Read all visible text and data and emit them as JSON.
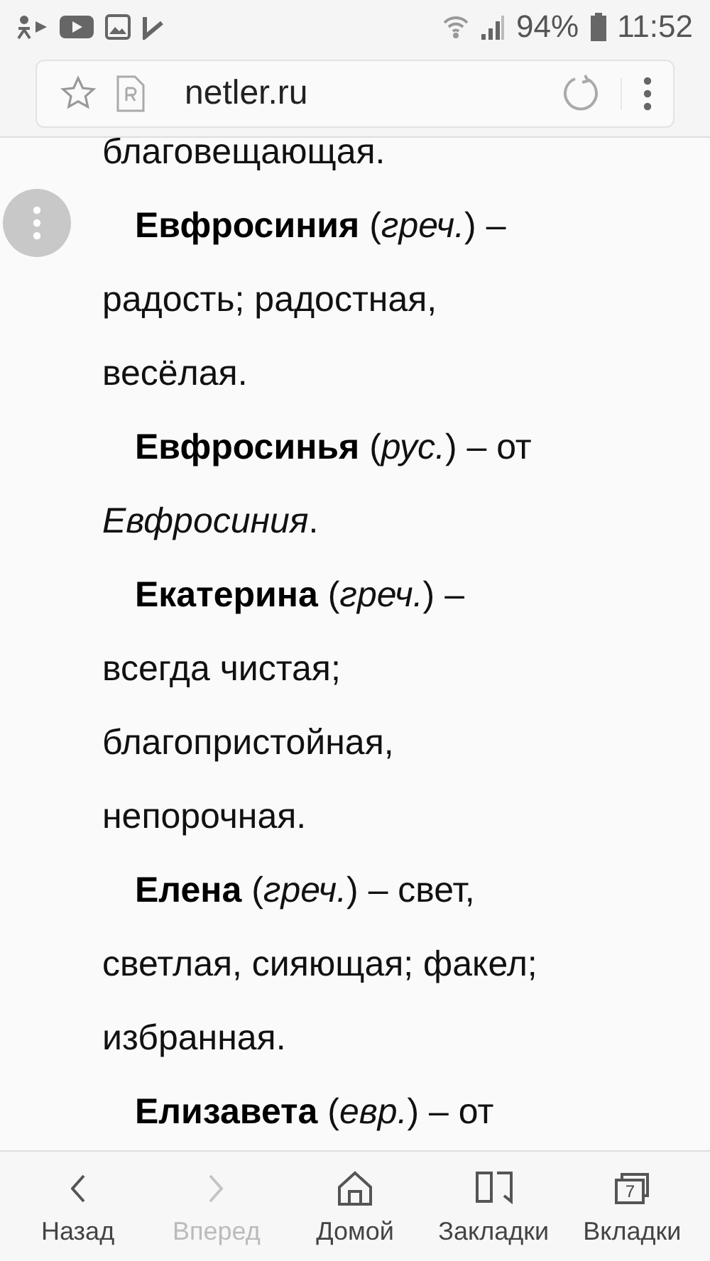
{
  "status_bar": {
    "battery": "94%",
    "time": "11:52"
  },
  "address_bar": {
    "url": "netler.ru"
  },
  "article": {
    "paragraphs": [
      {
        "continued": true,
        "lines": [
          "благовещающая."
        ]
      },
      {
        "continued": false,
        "lines": [
          "**Евфросиния** (*греч.*) –",
          "радость; радостная,",
          "весёлая."
        ]
      },
      {
        "continued": false,
        "lines": [
          "**Евфросинья** (*рус.*) – от",
          "*Евфросиния*."
        ]
      },
      {
        "continued": false,
        "lines": [
          "**Екатерина** (*греч.*) –",
          "всегда чистая;",
          "благопристойная,",
          "непорочная."
        ]
      },
      {
        "continued": false,
        "lines": [
          "**Елена** (*греч.*) – свет,",
          "светлая, сияющая; факел;",
          "избранная."
        ]
      },
      {
        "continued": false,
        "lines": [
          "**Елизавета** (*евр.*) – от"
        ]
      }
    ]
  },
  "bottom_nav": [
    {
      "kind": "back",
      "label": "Назад",
      "disabled": false
    },
    {
      "kind": "forward",
      "label": "Вперед",
      "disabled": true
    },
    {
      "kind": "home",
      "label": "Домой",
      "disabled": false
    },
    {
      "kind": "bookmarks",
      "label": "Закладки",
      "disabled": false
    },
    {
      "kind": "tabs",
      "label": "Вкладки",
      "disabled": false,
      "count": "7"
    }
  ]
}
